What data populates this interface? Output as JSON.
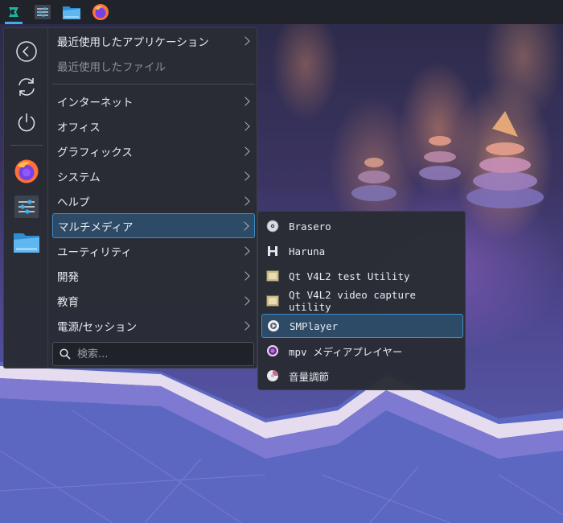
{
  "taskbar": {
    "icons": [
      "app-launcher-icon",
      "system-settings-icon",
      "file-manager-icon",
      "firefox-icon"
    ]
  },
  "sidebar": {
    "icons": [
      "back-icon",
      "refresh-icon",
      "power-icon",
      "firefox-icon",
      "system-settings-icon",
      "file-manager-icon"
    ]
  },
  "menu": {
    "recent_apps": "最近使用したアプリケーション",
    "recent_files": "最近使用したファイル",
    "categories": [
      "インターネット",
      "オフィス",
      "グラフィックス",
      "システム",
      "ヘルプ",
      "マルチメディア",
      "ユーティリティ",
      "開発",
      "教育",
      "電源/セッション"
    ],
    "selected_index": 5
  },
  "search": {
    "placeholder": "検索..."
  },
  "submenu": {
    "items": [
      "Brasero",
      "Haruna",
      "Qt V4L2 test Utility",
      "Qt V4L2 video capture utility",
      "SMPlayer",
      "mpv メディアプレイヤー",
      "音量調節"
    ],
    "selected_index": 4
  },
  "colors": {
    "accent": "#3daee9",
    "panel": "#292c34",
    "selection": "#2d4a66"
  }
}
